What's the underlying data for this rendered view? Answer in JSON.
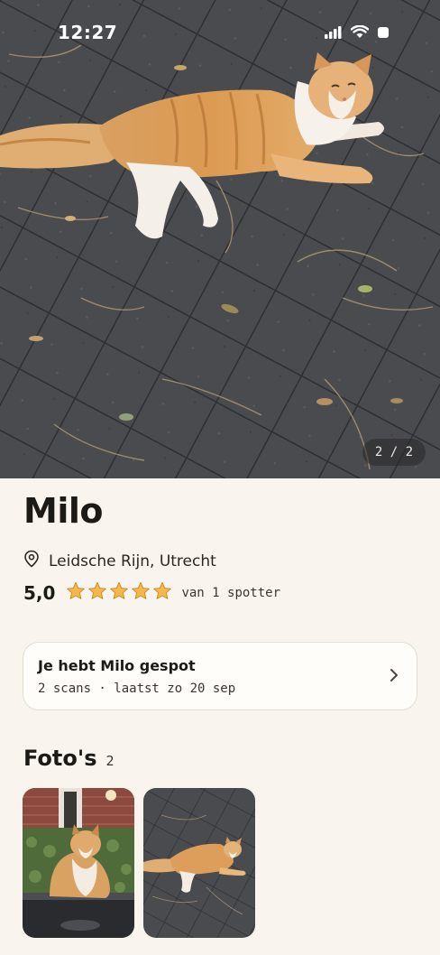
{
  "status_bar": {
    "time": "12:27"
  },
  "hero": {
    "counter": "2 / 2"
  },
  "cat": {
    "name": "Milo",
    "location": "Leidsche Rijn, Utrecht",
    "rating": "5,0",
    "rating_stars": 5,
    "rating_count": "van 1 spotter"
  },
  "spot_card": {
    "title": "Je hebt Milo gespot",
    "subtitle": "2 scans · laatst zo 20 sep"
  },
  "photos": {
    "title": "Foto's",
    "count": "2"
  },
  "colors": {
    "background": "#f9f5ee",
    "star": "#f2b84b",
    "card_border": "#e3ddd2"
  }
}
